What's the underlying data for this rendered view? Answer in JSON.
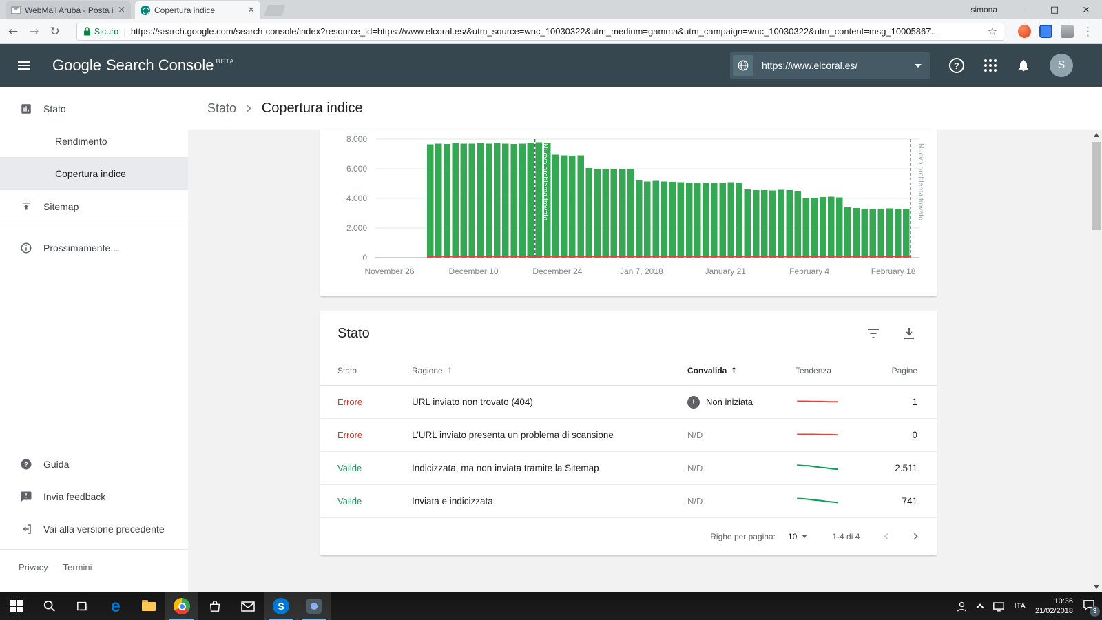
{
  "browser": {
    "tab1": "WebMail Aruba - Posta i",
    "tab2": "Copertura indice",
    "profile": "simona",
    "security": "Sicuro",
    "url": "https://search.google.com/search-console/index?resource_id=https://www.elcoral.es/&utm_source=wnc_10030322&utm_medium=gamma&utm_campaign=wnc_10030322&utm_content=msg_10005867..."
  },
  "icons": {
    "back": "←",
    "forward": "→",
    "reload": "↻",
    "star": "☆",
    "menu_dots": "⋮",
    "minimize": "–",
    "maximize": "□",
    "close": "×",
    "tab_close": "×",
    "sort_up": "↑",
    "chevron_left": "‹",
    "chevron_right": "›",
    "breadcrumb_sep": "›",
    "exclamation": "!",
    "question": "?",
    "omni_sep": "|"
  },
  "header": {
    "logo_google": "Google",
    "logo_rest": "Search Console",
    "beta": "BETA",
    "property": "https://www.elcoral.es/",
    "avatar_letter": "S"
  },
  "sidebar": {
    "items": [
      {
        "label": "Stato"
      },
      {
        "label": "Rendimento"
      },
      {
        "label": "Copertura indice",
        "selected": true
      },
      {
        "label": "Sitemap"
      },
      {
        "label": "Prossimamente..."
      }
    ],
    "bottom": [
      {
        "label": "Guida"
      },
      {
        "label": "Invia feedback"
      },
      {
        "label": "Vai alla versione precedente"
      }
    ],
    "privacy": "Privacy",
    "terms": "Termini"
  },
  "breadcrumb": {
    "parent": "Stato",
    "current": "Copertura indice"
  },
  "chart_data": {
    "type": "bar",
    "title": "Copertura indice",
    "ylim": [
      0,
      8000
    ],
    "yticks": [
      0,
      2000,
      4000,
      6000,
      8000
    ],
    "ytick_labels": [
      "0",
      "2.000",
      "4.000",
      "6.000",
      "8.000"
    ],
    "xtick_labels": [
      "November 26",
      "December 10",
      "December 24",
      "Jan 7, 2018",
      "January 21",
      "February 4",
      "February 18"
    ],
    "bar_color": "#34a853",
    "error_color": "#ea4335",
    "grid": true,
    "bars_start_frac": 0.095,
    "bars_end_frac": 0.985,
    "series": [
      {
        "name": "Valide",
        "type": "bar",
        "values": [
          7650,
          7700,
          7680,
          7720,
          7700,
          7690,
          7710,
          7700,
          7720,
          7700,
          7680,
          7700,
          7750,
          7780,
          7760,
          6950,
          6900,
          6880,
          6900,
          6050,
          6000,
          5980,
          6000,
          5990,
          5970,
          5200,
          5150,
          5180,
          5150,
          5120,
          5100,
          5050,
          5060,
          5040,
          5080,
          5050,
          5100,
          5060,
          4600,
          4550,
          4560,
          4540,
          4580,
          4550,
          4520,
          4000,
          4050,
          4100,
          4120,
          4080,
          3400,
          3350,
          3300,
          3280,
          3300,
          3320,
          3280,
          3300
        ]
      },
      {
        "name": "Errore",
        "type": "line",
        "approx_value": 1
      }
    ],
    "annotations": [
      {
        "label": "Nuovo problema trovato",
        "bar_index": 13
      },
      {
        "label": "Nuovo problema trovato",
        "bar_index": 58
      }
    ]
  },
  "table": {
    "title": "Stato",
    "columns": [
      {
        "label": "Stato"
      },
      {
        "label": "Ragione",
        "sort": "inactive"
      },
      {
        "label": "Convalida",
        "sort": "asc"
      },
      {
        "label": "Tendenza"
      },
      {
        "label": "Pagine"
      }
    ],
    "rows": [
      {
        "stato": "Errore",
        "color": "#d93025",
        "ragione": "URL inviato non trovato (404)",
        "convalida": "Non iniziata",
        "convalida_icon": true,
        "trend": [
          0.5,
          0.5,
          0.52,
          0.52,
          0.55,
          0.55
        ],
        "trend_color": "#ea4335",
        "pagine": "1"
      },
      {
        "stato": "Errore",
        "color": "#d93025",
        "ragione": "L’URL inviato presenta un problema di scansione",
        "convalida": "N/D",
        "convalida_icon": false,
        "trend": [
          0.5,
          0.5,
          0.5,
          0.52,
          0.52,
          0.55
        ],
        "trend_color": "#ea4335",
        "pagine": "0"
      },
      {
        "stato": "Valide",
        "color": "#0f9d58",
        "ragione": "Indicizzata, ma non inviata tramite la Sitemap",
        "convalida": "N/D",
        "convalida_icon": false,
        "trend": [
          0.25,
          0.3,
          0.32,
          0.42,
          0.5,
          0.55,
          0.65,
          0.7
        ],
        "trend_color": "#0f9d58",
        "pagine": "2.511"
      },
      {
        "stato": "Valide",
        "color": "#0f9d58",
        "ragione": "Inviata e indicizzata",
        "convalida": "N/D",
        "convalida_icon": false,
        "trend": [
          0.28,
          0.3,
          0.38,
          0.45,
          0.5,
          0.6,
          0.65,
          0.72
        ],
        "trend_color": "#0f9d58",
        "pagine": "741"
      }
    ],
    "footer": {
      "rows_label": "Righe per pagina:",
      "rows_value": "10",
      "range": "1-4 di 4"
    }
  },
  "taskbar": {
    "lang": "ITA",
    "time": "10:36",
    "date": "21/02/2018",
    "badge": "3"
  }
}
